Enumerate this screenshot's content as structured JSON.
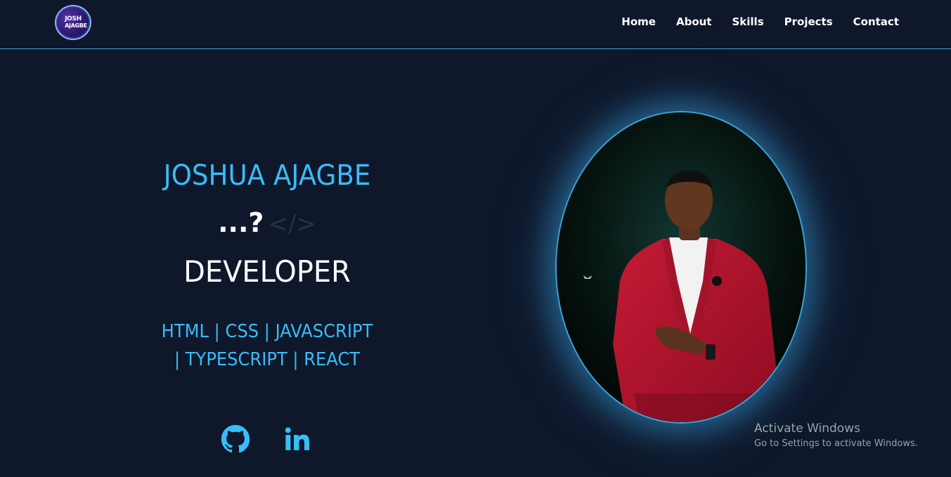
{
  "header": {
    "logo": {
      "line1": "JOSH",
      "line2": "AJAGBE"
    },
    "nav": [
      "Home",
      "About",
      "Skills",
      "Projects",
      "Contact"
    ]
  },
  "hero": {
    "name": "JOSHUA AJAGBE",
    "typing_text": "...?",
    "code_icon": "</>",
    "role": "DEVELOPER",
    "skills_line1": "HTML | CSS | JAVASCRIPT",
    "skills_line2": "| TYPESCRIPT | REACT"
  },
  "socials": [
    {
      "icon": "github-icon"
    },
    {
      "icon": "linkedin-icon"
    }
  ],
  "watermark": {
    "title": "Activate Windows",
    "subtitle": "Go to Settings to activate Windows."
  },
  "colors": {
    "background": "#0f172a",
    "accent": "#38bdf8",
    "text": "#ffffff"
  }
}
